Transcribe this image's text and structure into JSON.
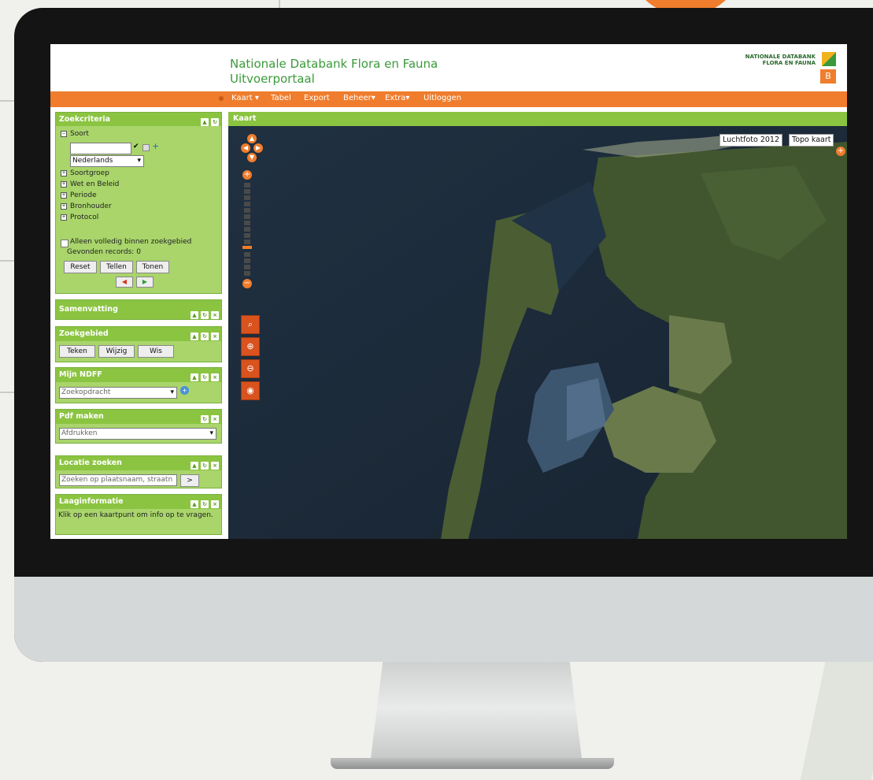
{
  "portal": {
    "title_line1": "Nationale Databank Flora en Fauna",
    "title_line2": "Uitvoerportaal",
    "logo_line1": "NATIONALE DATABANK",
    "logo_line2": "FLORA EN FAUNA",
    "logo_mark": "B",
    "colors": {
      "accent": "#ef7d2d",
      "panel_green": "#8bc441",
      "title_green": "#3a9a3b"
    }
  },
  "menu": {
    "items": [
      "Kaart",
      "Tabel",
      "Export",
      "Beheer",
      "Extra",
      "Uitloggen"
    ],
    "dropdown_arrow": "▾"
  },
  "panels": {
    "zoekcriteria": {
      "title": "Zoekcriteria",
      "tree_root": "Soort",
      "language_select": "Nederlands",
      "tree_items": [
        "Soortgroep",
        "Wet en Beleid",
        "Periode",
        "Bronhouder",
        "Protocol"
      ],
      "checkbox_label": "Alleen volledig binnen zoekgebied",
      "records_text": "Gevonden records: 0",
      "buttons": [
        "Reset",
        "Tellen",
        "Tonen"
      ]
    },
    "samenvatting": {
      "title": "Samenvatting"
    },
    "zoekgebied": {
      "title": "Zoekgebied",
      "buttons": [
        "Teken",
        "Wijzig",
        "Wis"
      ]
    },
    "mijn_ndff": {
      "title": "Mijn NDFF",
      "select_value": "Zoekopdracht"
    },
    "pdf": {
      "title": "Pdf maken",
      "select_value": "Afdrukken"
    },
    "locatie": {
      "title": "Locatie zoeken",
      "input_value": "Zoeken op plaatsnaam, straatn",
      "go_button": ">"
    },
    "laaginfo": {
      "title": "Laaginformatie",
      "text": "Klik op een kaartpunt om info op te vragen."
    }
  },
  "map": {
    "title": "Kaart",
    "layer_buttons": [
      "Luchtfoto 2012",
      "Topo kaart"
    ],
    "icons": [
      "pan-up-icon",
      "pan-left-icon",
      "pan-right-icon",
      "pan-down-icon",
      "zoom-in-icon",
      "zoom-out-icon",
      "zoom-box-icon",
      "zoom-plus-icon",
      "zoom-minus-icon",
      "eye-icon"
    ]
  }
}
